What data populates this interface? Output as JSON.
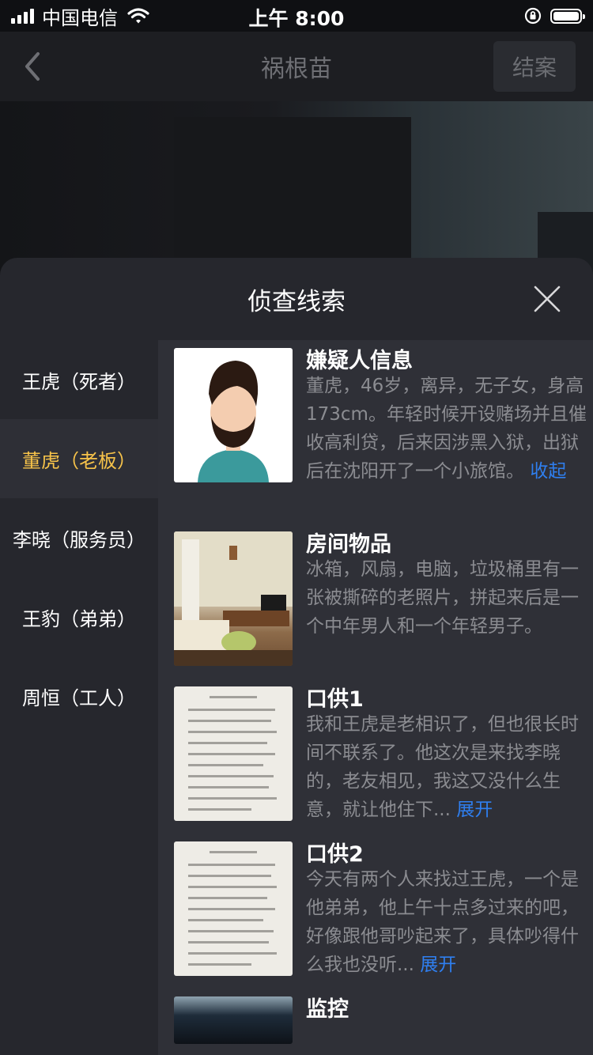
{
  "status_bar": {
    "carrier": "中国电信",
    "time": "上午 8:00"
  },
  "nav": {
    "title": "祸根苗",
    "action": "结案"
  },
  "sheet": {
    "title": "侦查线索",
    "menu": [
      {
        "label": "王虎（死者）"
      },
      {
        "label": "董虎（老板）",
        "active": true
      },
      {
        "label": "李晓（服务员）"
      },
      {
        "label": "王豹（弟弟）"
      },
      {
        "label": "周恒（工人）"
      }
    ],
    "clues": [
      {
        "title": "嫌疑人信息",
        "text": "董虎，46岁，离异，无子女，身高173cm。年轻时候开设赌场并且催收高利贷，后来因涉黑入狱，出狱后在沈阳开了一个小旅馆。",
        "link": "收起",
        "thumb_icon": "suspect-avatar-icon"
      },
      {
        "title": "房间物品",
        "text": "冰箱，风扇，电脑，垃圾桶里有一张被撕碎的老照片，拼起来后是一个中年男人和一个年轻男子。",
        "link": "",
        "thumb_icon": "room-photo"
      },
      {
        "title": "口供1",
        "text": "我和王虎是老相识了，但也很长时间不联系了。他这次是来找李晓的，老友相见，我这又没什么生意，就让他住下...",
        "link": "展开",
        "thumb_icon": "document-photo"
      },
      {
        "title": "口供2",
        "text": "今天有两个人来找过王虎，一个是他弟弟，他上午十点多过来的吧，好像跟他哥吵起来了，具体吵得什么我也没听...",
        "link": "展开",
        "thumb_icon": "document-photo"
      },
      {
        "title": "监控",
        "text": "",
        "link": "",
        "thumb_icon": "surveillance-photo"
      }
    ]
  },
  "colors": {
    "accent": "#f7c34a",
    "link": "#2f7ff0",
    "sheet_bg": "#26272d",
    "content_bg": "#2f3037",
    "body_text": "#8b8c91"
  }
}
